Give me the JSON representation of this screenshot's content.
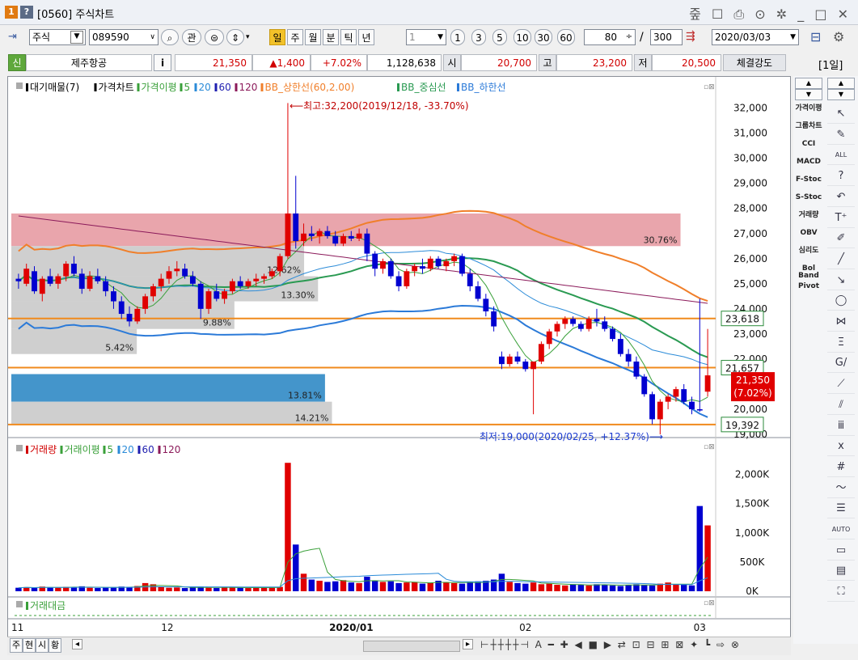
{
  "window": {
    "number": "1",
    "help": "?",
    "title": "[0560] 주식차트",
    "icons": "줖 ☐ ⎙ ⊙ ✲  _ □ ✕"
  },
  "toolbar": {
    "market": "주식",
    "code": "089590",
    "search_icon": "⌕",
    "watch_label": "관",
    "periods": [
      "일",
      "주",
      "월",
      "분",
      "틱",
      "년"
    ],
    "period_selected": "일",
    "interval_select": "1",
    "interval_buttons": [
      "1",
      "3",
      "5",
      "10",
      "30",
      "60"
    ],
    "count1": "80",
    "separator": "/",
    "count2": "300",
    "date": "2020/03/03"
  },
  "quote": {
    "badge": "신",
    "name": "제주항공",
    "info_button": "i",
    "price": "21,350",
    "change": "▲1,400",
    "change_pct": "+7.02%",
    "volume": "1,128,638",
    "open_label": "시",
    "open": "20,700",
    "high_label": "고",
    "high": "23,200",
    "low_label": "저",
    "low": "20,500",
    "strength_label": "체결강도",
    "period_label": "[1일]"
  },
  "price_panel": {
    "legend": [
      {
        "text": "대기매물(7)",
        "color": "#000000"
      },
      {
        "text": "가격차트",
        "color": "#000000"
      },
      {
        "text": "가격이평",
        "color": "#3aa03a"
      },
      {
        "text": "5",
        "color": "#3aa03a"
      },
      {
        "text": "20",
        "color": "#2b8bd8"
      },
      {
        "text": "60",
        "color": "#1f1fb0"
      },
      {
        "text": "120",
        "color": "#8b1a5a"
      },
      {
        "text": "BB_상한선(60,2.00)",
        "color": "#f07f2a"
      },
      {
        "text": "BB_중심선",
        "color": "#2a9a52"
      },
      {
        "text": "BB_하한선",
        "color": "#2b7ad8"
      }
    ],
    "annotation_high": "⟵최고:32,200(2019/12/18, -33.70%)",
    "annotation_low": "최저:19,000(2020/02/25, +12.37%)⟶",
    "price_ticks": [
      "32,000",
      "31,000",
      "30,000",
      "29,000",
      "28,000",
      "27,000",
      "26,000",
      "25,000",
      "24,000",
      "23,000",
      "22,000",
      "21,000",
      "20,000",
      "19,000"
    ],
    "level_labels": [
      "23,618",
      "21,657",
      "19,392"
    ],
    "current_price_label": "21,350",
    "current_pct_label": "(7.02%)",
    "supply_bands": [
      {
        "pct": "30.76%",
        "low": 26500,
        "high": 27800,
        "extent": 0.96,
        "color": "#e8a0a8"
      },
      {
        "pct": "12.62%",
        "low": 25300,
        "high": 26500,
        "extent": 0.42,
        "color": "#cccccc"
      },
      {
        "pct": "13.30%",
        "low": 24300,
        "high": 25300,
        "extent": 0.44,
        "color": "#cccccc"
      },
      {
        "pct": "9.88%",
        "low": 23200,
        "high": 24300,
        "extent": 0.32,
        "color": "#cccccc"
      },
      {
        "pct": "5.42%",
        "low": 22200,
        "high": 23200,
        "extent": 0.18,
        "color": "#cccccc"
      },
      {
        "pct": "13.81%",
        "low": 20300,
        "high": 21400,
        "extent": 0.45,
        "color": "#3a8fc8"
      },
      {
        "pct": "14.21%",
        "low": 19400,
        "high": 20300,
        "extent": 0.46,
        "color": "#cccccc"
      }
    ]
  },
  "volume_panel": {
    "legend": [
      {
        "text": "거래량",
        "color": "#d10000"
      },
      {
        "text": "거래이평",
        "color": "#3aa03a"
      },
      {
        "text": "5",
        "color": "#3aa03a"
      },
      {
        "text": "20",
        "color": "#2b8bd8"
      },
      {
        "text": "60",
        "color": "#1f1fb0"
      },
      {
        "text": "120",
        "color": "#8b1a5a"
      }
    ],
    "ticks": [
      "2,000K",
      "1,500K",
      "1,000K",
      "500K",
      "0K"
    ]
  },
  "amount_panel": {
    "legend": [
      {
        "text": "거래대금",
        "color": "#3aa03a"
      }
    ]
  },
  "x_axis": {
    "labels": [
      "11",
      "12",
      "2020/01",
      "02",
      "03"
    ]
  },
  "bottom_tabs": [
    "주",
    "현",
    "시",
    "황"
  ],
  "side_indicators": [
    "가격이평",
    "그룹차트",
    "CCI",
    "MACD",
    "F-Stoc",
    "S-Stoc",
    "거래량",
    "OBV",
    "심리도",
    "Bol Band",
    "Pivot"
  ],
  "drawing_tools": [
    "↖",
    "✎",
    "ALL",
    "?",
    "↶",
    "T⁺",
    "✐",
    "╱",
    "↘",
    "◯",
    "⋈",
    "Ξ",
    "G/",
    "⟋",
    "⫽",
    "ⅲ",
    "ⅹ",
    "#",
    "〜",
    "☰",
    "AUTO",
    "▭",
    "▤",
    "⛶"
  ],
  "chart_data": {
    "type": "candlestick",
    "x_axis": [
      "11",
      "12",
      "2020/01",
      "02",
      "03"
    ],
    "y_range": [
      19000,
      32000
    ],
    "candles": [
      [
        25200,
        25400,
        24800,
        25100
      ],
      [
        25000,
        25800,
        24900,
        25600
      ],
      [
        25500,
        25700,
        24600,
        24700
      ],
      [
        24600,
        25300,
        24300,
        25200
      ],
      [
        25300,
        25600,
        24900,
        25000
      ],
      [
        25000,
        25400,
        24800,
        25300
      ],
      [
        25300,
        25900,
        25100,
        25800
      ],
      [
        25800,
        26100,
        25300,
        25400
      ],
      [
        25400,
        25600,
        24600,
        24800
      ],
      [
        24800,
        25500,
        24700,
        25300
      ],
      [
        25300,
        25600,
        25000,
        25100
      ],
      [
        25100,
        25300,
        24500,
        24700
      ],
      [
        24700,
        24900,
        24000,
        24300
      ],
      [
        24300,
        24500,
        23600,
        23800
      ],
      [
        23800,
        24100,
        23300,
        23500
      ],
      [
        23500,
        24100,
        23400,
        24000
      ],
      [
        24000,
        24600,
        23800,
        24500
      ],
      [
        24500,
        25000,
        24300,
        24900
      ],
      [
        24900,
        25400,
        24700,
        25200
      ],
      [
        25200,
        25700,
        25000,
        25500
      ],
      [
        25500,
        25900,
        25300,
        25600
      ],
      [
        25600,
        25800,
        25200,
        25300
      ],
      [
        25300,
        25500,
        24900,
        25000
      ],
      [
        25000,
        25100,
        23600,
        24000
      ],
      [
        24000,
        24800,
        23800,
        24700
      ],
      [
        24700,
        25000,
        24300,
        24400
      ],
      [
        24400,
        24800,
        24200,
        24700
      ],
      [
        24700,
        25200,
        24600,
        25100
      ],
      [
        25100,
        25300,
        24800,
        24900
      ],
      [
        24900,
        25200,
        24800,
        25100
      ],
      [
        25100,
        25400,
        24900,
        25200
      ],
      [
        25200,
        25400,
        25000,
        25300
      ],
      [
        25300,
        25600,
        25200,
        25500
      ],
      [
        25500,
        26200,
        25300,
        26100
      ],
      [
        26100,
        32200,
        26000,
        27800
      ],
      [
        27800,
        29300,
        26400,
        26700
      ],
      [
        26700,
        27400,
        26500,
        27000
      ],
      [
        27000,
        27300,
        26700,
        26900
      ],
      [
        26900,
        27200,
        26600,
        27100
      ],
      [
        27100,
        27300,
        26800,
        26900
      ],
      [
        26900,
        27100,
        26500,
        26600
      ],
      [
        26600,
        27000,
        26500,
        26900
      ],
      [
        26900,
        27100,
        26700,
        26800
      ],
      [
        26800,
        27200,
        26700,
        27000
      ],
      [
        27000,
        27200,
        25900,
        26200
      ],
      [
        26200,
        26300,
        25300,
        25600
      ],
      [
        25600,
        26000,
        25400,
        25900
      ],
      [
        25900,
        26000,
        25200,
        25300
      ],
      [
        25300,
        25500,
        24700,
        24900
      ],
      [
        24900,
        25600,
        24800,
        25500
      ],
      [
        25500,
        25800,
        25300,
        25700
      ],
      [
        25700,
        26000,
        25400,
        25600
      ],
      [
        25600,
        26100,
        25500,
        26000
      ],
      [
        26000,
        26100,
        25600,
        25700
      ],
      [
        25700,
        26000,
        25500,
        25900
      ],
      [
        25900,
        26200,
        25700,
        26100
      ],
      [
        26100,
        26200,
        25300,
        25400
      ],
      [
        25400,
        25600,
        24700,
        24900
      ],
      [
        24900,
        25100,
        24300,
        24400
      ],
      [
        24400,
        24600,
        23700,
        23900
      ],
      [
        23900,
        24100,
        23100,
        23300
      ],
      [
        22100,
        22300,
        21600,
        21800
      ],
      [
        21800,
        22200,
        21700,
        22100
      ],
      [
        22100,
        22300,
        21800,
        21900
      ],
      [
        21900,
        22000,
        21500,
        21600
      ],
      [
        21600,
        21900,
        19800,
        21900
      ],
      [
        21900,
        22700,
        21800,
        22600
      ],
      [
        22600,
        23200,
        22400,
        23100
      ],
      [
        23100,
        23500,
        22900,
        23400
      ],
      [
        23400,
        23700,
        23200,
        23600
      ],
      [
        23600,
        23700,
        23300,
        23400
      ],
      [
        23400,
        23500,
        23100,
        23200
      ],
      [
        23200,
        23700,
        23100,
        23600
      ],
      [
        23600,
        24000,
        23300,
        23500
      ],
      [
        23500,
        23700,
        23100,
        23200
      ],
      [
        23200,
        23300,
        22700,
        22800
      ],
      [
        22800,
        23000,
        22100,
        22200
      ],
      [
        22200,
        22400,
        21700,
        21900
      ],
      [
        21900,
        22100,
        21200,
        21300
      ],
      [
        21300,
        21400,
        20500,
        20600
      ],
      [
        20600,
        20700,
        19400,
        19600
      ],
      [
        19600,
        20400,
        19000,
        20300
      ],
      [
        20300,
        20600,
        20000,
        20500
      ],
      [
        20500,
        20900,
        20300,
        20800
      ],
      [
        20800,
        21000,
        20200,
        20300
      ],
      [
        20300,
        20500,
        19800,
        20000
      ],
      [
        20000,
        24400,
        19900,
        19950
      ],
      [
        20700,
        23200,
        20500,
        21350
      ]
    ],
    "volume": [
      60,
      70,
      55,
      80,
      65,
      60,
      75,
      70,
      85,
      60,
      55,
      65,
      70,
      80,
      75,
      90,
      140,
      120,
      70,
      60,
      65,
      55,
      75,
      80,
      60,
      55,
      70,
      65,
      60,
      55,
      70,
      65,
      60,
      75,
      2200,
      800,
      300,
      200,
      180,
      160,
      170,
      190,
      150,
      140,
      250,
      180,
      160,
      170,
      140,
      150,
      160,
      130,
      140,
      180,
      150,
      140,
      130,
      160,
      170,
      180,
      200,
      300,
      160,
      140,
      130,
      150,
      120,
      130,
      110,
      100,
      120,
      110,
      100,
      120,
      110,
      100,
      90,
      110,
      120,
      110,
      100,
      130,
      150,
      120,
      110,
      100,
      1460,
      1128
    ]
  }
}
